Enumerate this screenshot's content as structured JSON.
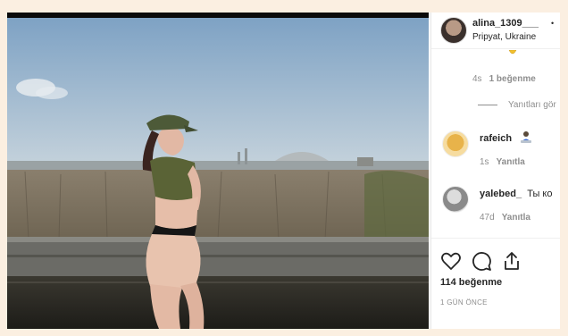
{
  "post": {
    "username": "alina_1309___",
    "location": "Pripyat, Ukraine",
    "more_glyph": "•"
  },
  "comments": [
    {
      "user": "",
      "text": "",
      "time": "4s",
      "likes": "1 beğenme"
    },
    {
      "reply_toggle": "Yanıtları gör"
    },
    {
      "user": "rafeich",
      "text": "",
      "time": "1s",
      "reply": "Yanıtla"
    },
    {
      "user": "yalebed_",
      "text": "Ты ко",
      "time": "47d",
      "reply": "Yanıtla"
    }
  ],
  "likes_count": "114 beğenme",
  "post_date": "1 GÜN ÖNCE",
  "icons": {
    "like": "heart-icon",
    "comment": "comment-icon",
    "share": "share-icon",
    "emoji": "laptop-person-emoji-icon",
    "partial_emoji": "grin-emoji-icon"
  },
  "colors": {
    "background": "#fbefe1",
    "text": "#262626",
    "muted": "#8e8e8e"
  }
}
